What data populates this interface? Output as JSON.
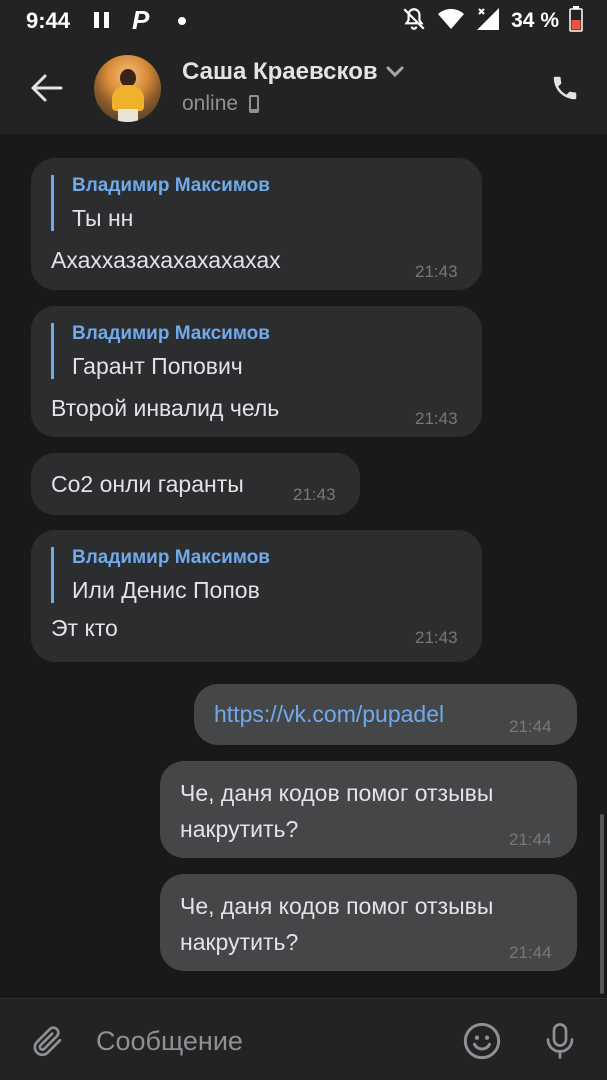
{
  "status_bar": {
    "time": "9:44",
    "app_letter": "P",
    "battery_text": "34 %",
    "icons": [
      "pause-icon",
      "p-app-icon",
      "notification-dot-icon",
      "mute-icon",
      "wifi-icon",
      "signal-icon",
      "battery-icon"
    ]
  },
  "header": {
    "contact_name": "Саша Краевсков",
    "contact_status": "online",
    "icons": [
      "back-arrow-icon",
      "chevron-down-icon",
      "mobile-device-icon",
      "phone-icon"
    ]
  },
  "messages": [
    {
      "direction": "in",
      "reply_author": "Владимир Максимов",
      "reply_text": "Ты нн",
      "text": "Ахаххазахахахахахах",
      "time": "21:43"
    },
    {
      "direction": "in",
      "reply_author": "Владимир Максимов",
      "reply_text": "Гарант Попович",
      "text": "Второй инвалид чель",
      "time": "21:43"
    },
    {
      "direction": "in",
      "text": "Со2 онли гаранты",
      "time": "21:43"
    },
    {
      "direction": "in",
      "reply_author": "Владимир Максимов",
      "reply_text": "Или Денис Попов",
      "text": "Эт кто",
      "time": "21:43"
    },
    {
      "direction": "out",
      "text": "https://vk.com/pupadel",
      "is_link": true,
      "time": "21:44"
    },
    {
      "direction": "out",
      "text": "Че, даня кодов помог отзывы накрутить?",
      "time": "21:44"
    },
    {
      "direction": "out",
      "text": "Че, даня кодов помог отзывы накрутить?",
      "time": "21:44"
    }
  ],
  "composer": {
    "placeholder": "Сообщение",
    "icons": [
      "paperclip-icon",
      "emoji-icon",
      "microphone-icon"
    ]
  },
  "colors": {
    "background": "#19191a",
    "bar": "#232324",
    "incoming_bubble": "#2c2d2e",
    "outgoing_bubble": "#454647",
    "accent": "#71aaeb"
  }
}
